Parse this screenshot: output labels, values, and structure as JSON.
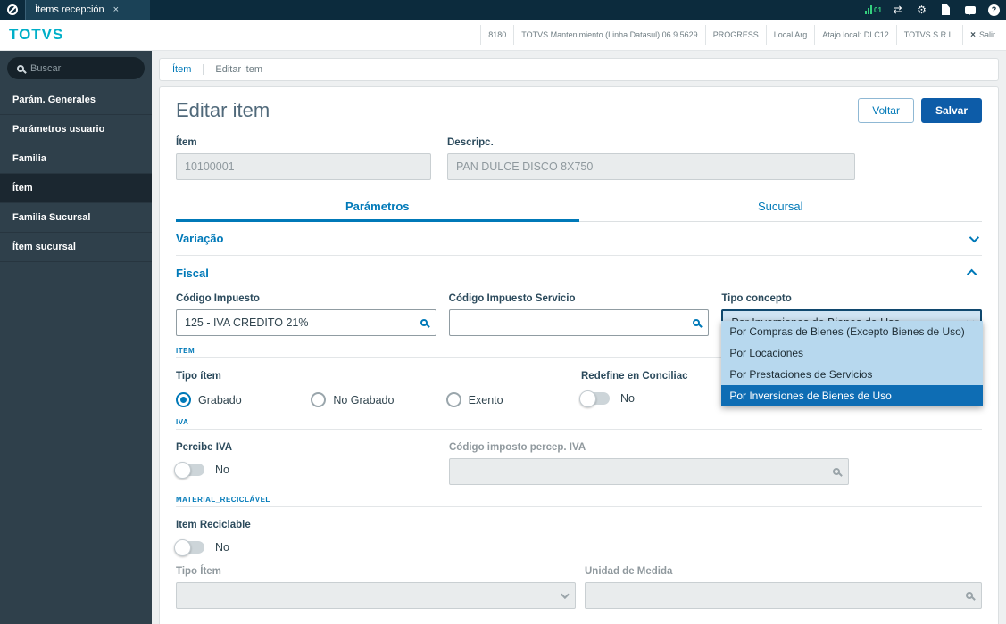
{
  "topbar": {
    "tab_label": "Ítems recepción",
    "close_glyph": "×",
    "signal_label": "01",
    "shuffle_glyph": "⇄",
    "gear_glyph": "⚙",
    "help_glyph": "?"
  },
  "header": {
    "logo": "TOTVS",
    "info": [
      "8180",
      "TOTVS Mantenimiento (Linha Datasul) 06.9.5629",
      "PROGRESS",
      "Local Arg",
      "Atajo local: DLC12",
      "TOTVS S.R.L."
    ],
    "exit_glyph": "×",
    "exit_label": "Salir"
  },
  "sidebar": {
    "search_placeholder": "Buscar",
    "items": [
      {
        "label": "Parám. Generales"
      },
      {
        "label": "Parámetros usuario"
      },
      {
        "label": "Familia"
      },
      {
        "label": "Ítem"
      },
      {
        "label": "Familia Sucursal"
      },
      {
        "label": "Ítem sucursal"
      }
    ]
  },
  "breadcrumb": {
    "section": "Ítem",
    "page": "Editar item"
  },
  "page": {
    "title": "Editar item",
    "back_label": "Voltar",
    "save_label": "Salvar"
  },
  "form": {
    "item": {
      "label": "Ítem",
      "value": "10100001"
    },
    "descripc": {
      "label": "Descripc.",
      "value": "PAN DULCE DISCO 8X750"
    },
    "tabs": [
      {
        "label": "Parámetros"
      },
      {
        "label": "Sucursal"
      }
    ],
    "sections": [
      {
        "label": "Variação"
      },
      {
        "label": "Fiscal"
      }
    ],
    "fiscal": {
      "codigo_impuesto": {
        "label": "Código Impuesto",
        "value": "125 - IVA CREDITO 21%"
      },
      "codigo_impuesto_servicio": {
        "label": "Código Impuesto Servicio",
        "value": ""
      },
      "tipo_concepto": {
        "label": "Tipo concepto",
        "value": "Por Inversiones de Bienes de Uso",
        "options": [
          {
            "label": "Por Compras de Bienes (Excepto Bienes de Uso)"
          },
          {
            "label": "Por Locaciones"
          },
          {
            "label": "Por Prestaciones de Servicios"
          },
          {
            "label": "Por Inversiones de Bienes de Uso"
          }
        ]
      },
      "group_item": "ITEM",
      "tipo_item": {
        "label": "Tipo ítem",
        "selected": "Grabado",
        "options": [
          {
            "label": "Grabado"
          },
          {
            "label": "No Grabado"
          },
          {
            "label": "Exento"
          }
        ]
      },
      "redefine": {
        "label": "Redefine en Conciliac",
        "state": "No"
      },
      "group_iva": "IVA",
      "percibe_iva": {
        "label": "Percibe IVA",
        "state": "No"
      },
      "codigo_percep": {
        "label": "Código imposto percep. IVA",
        "value": ""
      },
      "group_material": "MATERIAL_RECICLÁVEL",
      "item_reciclable": {
        "label": "Item Reciclable",
        "state": "No"
      },
      "tipo_item_select": {
        "label": "Tipo Ítem",
        "value": ""
      },
      "unidad_medida": {
        "label": "Unidad de Medida",
        "value": ""
      }
    }
  },
  "colors": {
    "primary": "#0079b8",
    "save_button": "#0d5ca8",
    "topbar_bg": "#0c2b3d",
    "logo": "#00afc8",
    "selected_option_bg": "#0e6db4",
    "dropdown_bg": "#b7d8ee"
  }
}
